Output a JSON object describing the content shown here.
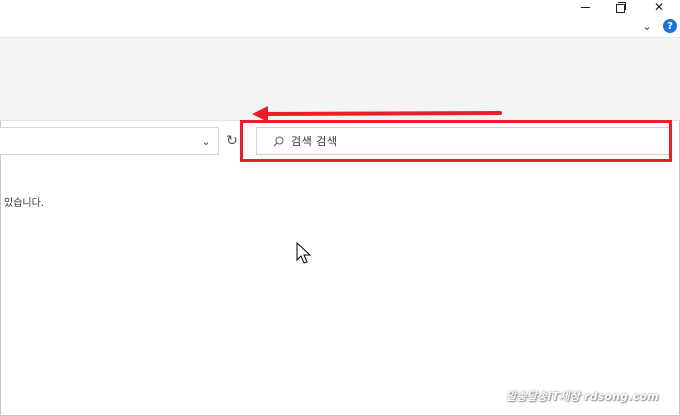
{
  "window": {
    "minimize_label": "minimize",
    "restore_label": "restore",
    "close_label": "close"
  },
  "toolbar": {
    "expand_ribbon_icon": "chevron-down-icon",
    "help_icon_glyph": "?"
  },
  "address_bar": {
    "dropdown_glyph": "⌄",
    "refresh_glyph": "↻"
  },
  "search": {
    "text": "검색 검색",
    "icon": "search-icon"
  },
  "content": {
    "message": "있습니다."
  },
  "annotation": {
    "highlight_color": "#e8202a",
    "arrow_color": "#e8202a"
  },
  "watermark": {
    "text": "알송달송IT세상 rdsong.com"
  }
}
